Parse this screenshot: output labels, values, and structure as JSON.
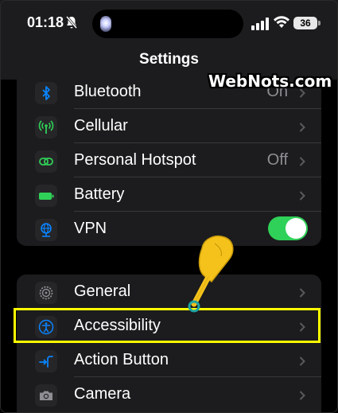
{
  "status_bar": {
    "time": "01:18",
    "battery_level": "36"
  },
  "nav": {
    "title": "Settings"
  },
  "watermark": "WebNots.com",
  "colors": {
    "background": "#000000",
    "group": "#1c1c1e",
    "toggle_on": "#30d158",
    "highlight": "#ffff00",
    "secondary_text": "#8e8e93"
  },
  "groups": [
    {
      "items": [
        {
          "label": "Bluetooth",
          "value": "On",
          "icon": "bluetooth-icon"
        },
        {
          "label": "Cellular",
          "icon": "antenna-icon"
        },
        {
          "label": "Personal Hotspot",
          "value": "Off",
          "icon": "link-icon"
        },
        {
          "label": "Battery",
          "icon": "battery-icon"
        },
        {
          "label": "VPN",
          "icon": "globe-icon",
          "toggle": true
        }
      ]
    },
    {
      "items": [
        {
          "label": "General",
          "icon": "gear-icon"
        },
        {
          "label": "Accessibility",
          "icon": "accessibility-icon",
          "highlighted": true
        },
        {
          "label": "Action Button",
          "icon": "action-button-icon"
        },
        {
          "label": "Camera",
          "icon": "camera-icon"
        }
      ]
    }
  ]
}
